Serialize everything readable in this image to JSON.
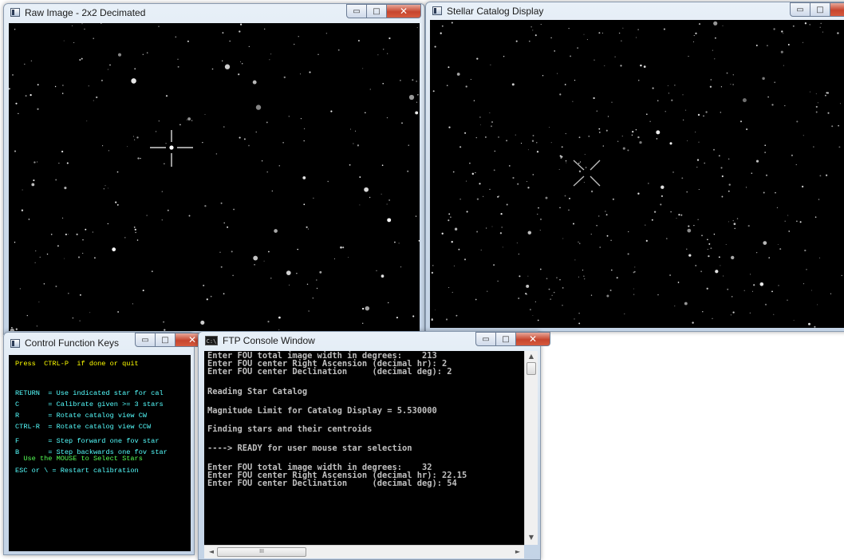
{
  "raw_window": {
    "title": "Raw Image  -  2x2 Decimated",
    "minimize_glyph": "▭",
    "maximize_glyph": "□",
    "close_glyph": "✕"
  },
  "catalog_window": {
    "title": "Stellar Catalog Display",
    "minimize_glyph": "▭",
    "maximize_glyph": "□",
    "close_glyph": "✕"
  },
  "keys_window": {
    "title": "Control Function Keys",
    "minimize_glyph": "▭",
    "maximize_glyph": "□",
    "close_glyph": "✕",
    "prompt": "Press  CTRL-P  if done or quit",
    "keys": [
      "RETURN  = Use indicated star for cal",
      "C       = Calibrate given >= 3 stars",
      "R       = Rotate catalog view CW",
      "CTRL-R  = Rotate catalog view CCW",
      "F       = Step forward one fov star",
      "B       = Step backwards one fov star"
    ],
    "mouse_hint": "  Use the MOUSE to Select Stars",
    "escape_hint": "ESC or \\ = Restart calibration"
  },
  "console_window": {
    "title": "FTP Console Window",
    "icon": "C:\\",
    "minimize_glyph": "▭",
    "maximize_glyph": "□",
    "close_glyph": "✕",
    "lines": [
      "Enter FOU total image width in degrees:    213",
      "Enter FOU center Right Ascension (decimal hr): 2",
      "Enter FOU center Declination     (decimal deg): 2",
      "",
      "Reading Star Catalog",
      "",
      "Magnitude Limit for Catalog Display = 5.530000",
      "",
      "Finding stars and their centroids",
      "",
      "----> READY for user mouse star selection",
      "",
      "Enter FOU total image width in degrees:    32",
      "Enter FOU center Right Ascension (decimal hr): 22.15",
      "Enter FOU center Declination     (decimal deg): 54"
    ],
    "scroll_up": "▲",
    "scroll_down": "▼",
    "scroll_left": "◄",
    "scroll_right": "►",
    "hthumb_grip": "III"
  },
  "colors": {
    "key_prompt": "#ffff00",
    "key_text": "#55ffff",
    "key_mouse": "#55ff55",
    "console_text": "#c0c0c0",
    "close_button": "#c7452e"
  }
}
